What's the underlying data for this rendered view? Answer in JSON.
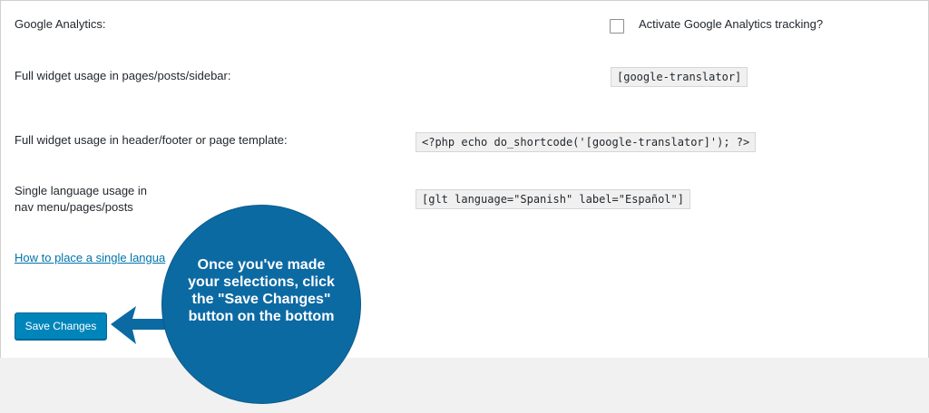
{
  "settings": {
    "google_analytics": {
      "label": "Google Analytics:",
      "checkbox_label": "Activate Google Analytics tracking?",
      "checked": false
    },
    "full_widget_pages": {
      "label": "Full widget usage in pages/posts/sidebar:",
      "code": "[google-translator]"
    },
    "full_widget_template": {
      "label": "Full widget usage in header/footer or page template:",
      "code": "<?php echo do_shortcode('[google-translator]'); ?>"
    },
    "single_language": {
      "label_line1": "Single language usage in",
      "label_line2": "nav menu/pages/posts",
      "code": "[glt language=\"Spanish\" label=\"Español\"]"
    },
    "help_link": "How to place a single langua"
  },
  "save_button": {
    "label": "Save Changes"
  },
  "callout": {
    "text": "Once you've made your selections, click the \"Save Changes\" button on the bottom",
    "color": "#0c6aa3"
  },
  "colors": {
    "button_blue": "#0085ba",
    "link_blue": "#0073aa",
    "page_background": "#f1f1f1"
  }
}
